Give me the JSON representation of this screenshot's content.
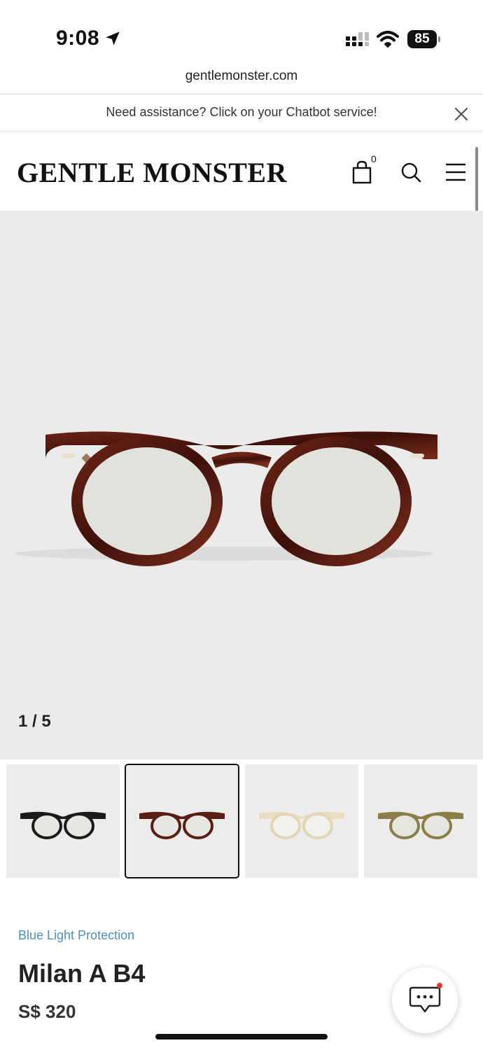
{
  "status_bar": {
    "time": "9:08",
    "battery": "85",
    "icons": [
      "location-arrow-icon",
      "signal-icon",
      "wifi-icon",
      "battery-icon"
    ]
  },
  "browser": {
    "url": "gentlemonster.com"
  },
  "banner": {
    "text": "Need assistance? Click on your Chatbot service!",
    "close_icon": "close-icon"
  },
  "header": {
    "logo": "GENTLE MONSTER",
    "cart_count": "0",
    "icons": [
      "shopping-bag-icon",
      "search-icon",
      "menu-icon"
    ]
  },
  "gallery": {
    "counter": "1 / 5",
    "thumbnails": [
      {
        "color": "#1a1a1a",
        "label": "black frame"
      },
      {
        "color": "#5a1f14",
        "label": "tortoise frame",
        "selected": true
      },
      {
        "color": "#e9dcc0",
        "label": "clear frame"
      },
      {
        "color": "#8a7d45",
        "label": "olive frame"
      }
    ]
  },
  "product": {
    "category": "Blue Light Protection",
    "name": "Milan A B4",
    "price": "S$ 320"
  },
  "colors": {
    "accent_link": "#4a90c8",
    "hero_background": "#ebebeb",
    "notification_dot": "#e8322b"
  }
}
